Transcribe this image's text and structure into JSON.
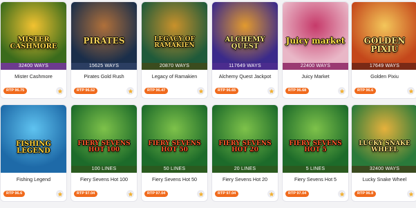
{
  "colors": {
    "rtp_badge": "#f06a1c",
    "star_icon": "#f2b134",
    "card_background": "#ffffff",
    "page_background": "#f3f3f5"
  },
  "games": [
    {
      "name": "Mister Cashmore",
      "logo": "MISTER CASHMORE",
      "ways": "32400 WAYS",
      "rtp": "RTP 96.75",
      "icon": "star-icon",
      "colors": {
        "bg1": "#3a6b1c",
        "bg2": "#f2c230",
        "band": "#6d3b8e",
        "logo": "#ffd84a"
      }
    },
    {
      "name": "Pirates Gold Rush",
      "logo": "PIRATES",
      "ways": "15625 WAYS",
      "rtp": "RTP 96.52",
      "icon": "star-icon",
      "colors": {
        "bg1": "#1a2e4a",
        "bg2": "#b0703a",
        "band": "#2b3e62",
        "logo": "#f6d35b"
      }
    },
    {
      "name": "Legacy of Ramakien",
      "logo": "LEGACY OF RAMAKIEN",
      "ways": "20870 WAYS",
      "rtp": "RTP 96.47",
      "icon": "star-icon",
      "colors": {
        "bg1": "#1f5a3a",
        "bg2": "#c9912b",
        "band": "#3b4c1e",
        "logo": "#f7d050"
      }
    },
    {
      "name": "Alchemy Quest Jackpot",
      "logo": "ALCHEMY QUEST",
      "ways": "117649 WAYS",
      "rtp": "RTP 96.65",
      "icon": "star-icon",
      "colors": {
        "bg1": "#3b2a8a",
        "bg2": "#e29a2e",
        "band": "#4b2c8e",
        "logo": "#f3e07a"
      }
    },
    {
      "name": "Juicy Market",
      "logo": "Juicy market",
      "ways": "22400 WAYS",
      "rtp": "RTP 96.68",
      "icon": "star-icon",
      "colors": {
        "bg1": "#e9b7c7",
        "bg2": "#c63a6a",
        "band": "#9a3a72",
        "logo": "#ffe24a"
      }
    },
    {
      "name": "Golden Pixiu",
      "logo": "GOLDEN PIXIU",
      "ways": "17649 WAYS",
      "rtp": "RTP 96.6",
      "icon": "star-icon",
      "colors": {
        "bg1": "#c4471b",
        "bg2": "#f3c65a",
        "band": "#7a2a16",
        "logo": "#ffe07a"
      }
    },
    {
      "name": "Fishing Legend",
      "logo": "FISHING LEGEND",
      "ways": "",
      "rtp": "RTP 96.6",
      "icon": "star-icon",
      "colors": {
        "bg1": "#1e6aa8",
        "bg2": "#5fc3f0",
        "band": "#1e6aa8",
        "logo": "#ffd23a"
      }
    },
    {
      "name": "Fiery Sevens Hot 100",
      "logo": "FIERY SEVENS HOT 100",
      "ways": "100 LINES",
      "rtp": "RTP 97.04",
      "icon": "star-icon",
      "colors": {
        "bg1": "#1d6b2a",
        "bg2": "#7ec24a",
        "band": "#2a5a1f",
        "logo": "#ff5a2a"
      }
    },
    {
      "name": "Fiery Sevens Hot 50",
      "logo": "FIERY SEVENS HOT 50",
      "ways": "50 LINES",
      "rtp": "RTP 97.04",
      "icon": "star-icon",
      "colors": {
        "bg1": "#1d6b2a",
        "bg2": "#7ec24a",
        "band": "#2a5a1f",
        "logo": "#ff5a2a"
      }
    },
    {
      "name": "Fiery Sevens Hot 20",
      "logo": "FIERY SEVENS HOT 20",
      "ways": "20 LINES",
      "rtp": "RTP 97.04",
      "icon": "star-icon",
      "colors": {
        "bg1": "#1d6b2a",
        "bg2": "#7ec24a",
        "band": "#2a5a1f",
        "logo": "#ff5a2a"
      }
    },
    {
      "name": "Fiery Sevens Hot 5",
      "logo": "FIERY SEVENS HOT 5",
      "ways": "5 LINES",
      "rtp": "RTP 97.04",
      "icon": "star-icon",
      "colors": {
        "bg1": "#1d6b2a",
        "bg2": "#7ec24a",
        "band": "#2a5a1f",
        "logo": "#ff5a2a"
      }
    },
    {
      "name": "Lucky Snake Wheel",
      "logo": "LUCKY SNAKE WHEEL",
      "ways": "32400 WAYS",
      "rtp": "RTP 96.8",
      "icon": "star-icon",
      "colors": {
        "bg1": "#2a7a3a",
        "bg2": "#e6b13c",
        "band": "#3a4a1f",
        "logo": "#fbe07a"
      }
    }
  ]
}
